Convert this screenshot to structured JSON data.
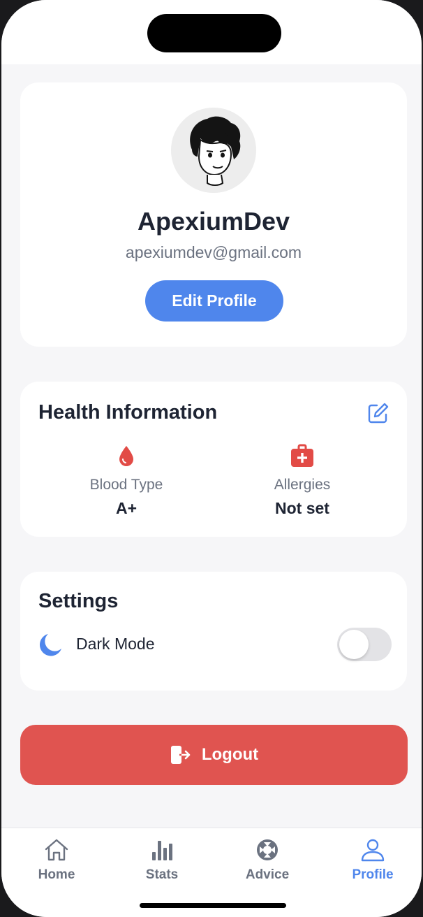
{
  "profile": {
    "username": "ApexiumDev",
    "email": "apexiumdev@gmail.com",
    "edit_label": "Edit Profile"
  },
  "health": {
    "title": "Health Information",
    "blood_type_label": "Blood Type",
    "blood_type_value": "A+",
    "allergies_label": "Allergies",
    "allergies_value": "Not set"
  },
  "settings": {
    "title": "Settings",
    "dark_mode_label": "Dark Mode",
    "dark_mode_enabled": false
  },
  "logout_label": "Logout",
  "tabs": [
    {
      "label": "Home",
      "icon": "home-icon"
    },
    {
      "label": "Stats",
      "icon": "bar-chart-icon"
    },
    {
      "label": "Advice",
      "icon": "lifebuoy-icon"
    },
    {
      "label": "Profile",
      "icon": "person-icon",
      "active": true
    }
  ],
  "colors": {
    "accent": "#4f86ec",
    "danger": "#e05450",
    "text_dark": "#1e2433",
    "text_muted": "#6b7280",
    "background": "#f6f6f8"
  }
}
